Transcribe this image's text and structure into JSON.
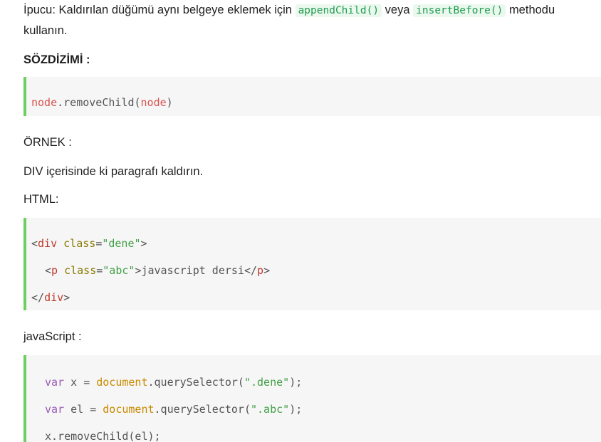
{
  "tip": {
    "prefix": "İpucu: Kaldırılan düğümü aynı belgeye eklemek için",
    "code1": "appendChild()",
    "middle": "veya",
    "code2": "insertBefore()",
    "suffix": "methodu",
    "line2": "kullanın."
  },
  "syntax_heading": "SÖZDİZİMİ :",
  "syntax_code": {
    "obj": "node",
    "dot": ".",
    "method": "removeChild",
    "open": "(",
    "arg": "node",
    "close": ")"
  },
  "example_heading": "ÖRNEK :",
  "example_desc": "DIV içerisinde ki paragrafı kaldırın.",
  "html_label": "HTML:",
  "html_code": {
    "line1": {
      "lt": "<",
      "tag": "div",
      "attr": "class",
      "eq": "=",
      "val": "\"dene\"",
      "gt": ">"
    },
    "line2": {
      "lt": "<",
      "tag": "p",
      "attr": "class",
      "eq": "=",
      "val": "\"abc\"",
      "gt": ">",
      "text": "javascript dersi",
      "close_lt": "</",
      "close_tag": "p",
      "close_gt": ">"
    },
    "line3": {
      "lt": "</",
      "tag": "div",
      "gt": ">"
    }
  },
  "js_label": "javaScript :",
  "js_code": {
    "line1": {
      "kw": "var",
      "name": "x",
      "eq": "=",
      "obj": "document",
      "call": ".querySelector(",
      "str": "\".dene\"",
      "end": ");"
    },
    "line2": {
      "kw": "var",
      "name": "el",
      "eq": "=",
      "obj": "document",
      "call": ".querySelector(",
      "str": "\".abc\"",
      "end": ");"
    },
    "line3": {
      "text": "x.removeChild(el);"
    }
  }
}
